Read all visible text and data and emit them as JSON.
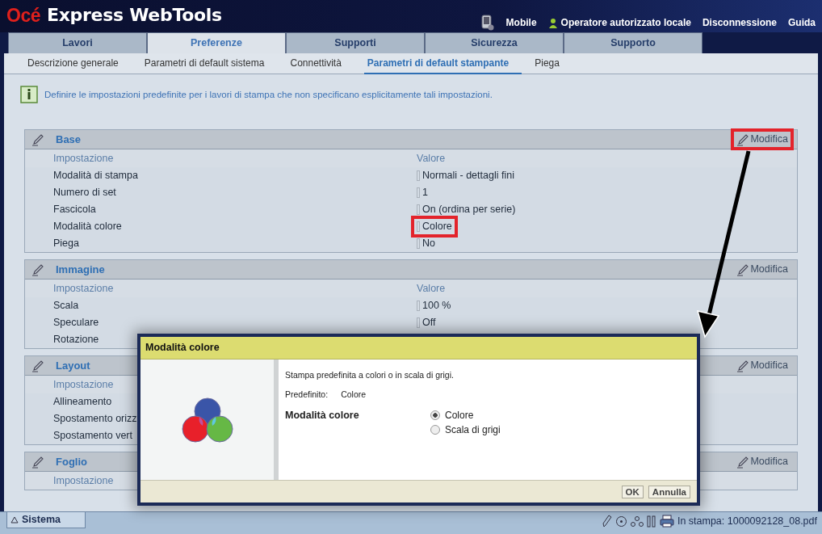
{
  "app": {
    "brand": "Océ",
    "title": "Express WebTools"
  },
  "header_links": [
    {
      "kind": "mobile",
      "label": "Mobile"
    },
    {
      "kind": "user",
      "label": "Operatore autorizzato locale"
    },
    {
      "kind": "plain",
      "label": "Disconnessione"
    },
    {
      "kind": "plain",
      "label": "Guida"
    }
  ],
  "tabs": [
    {
      "label": "Lavori",
      "selected": false
    },
    {
      "label": "Preferenze",
      "selected": true
    },
    {
      "label": "Supporti",
      "selected": false
    },
    {
      "label": "Sicurezza",
      "selected": false
    },
    {
      "label": "Supporto",
      "selected": false
    }
  ],
  "subtabs": [
    {
      "label": "Descrizione generale",
      "selected": false
    },
    {
      "label": "Parametri di default sistema",
      "selected": false
    },
    {
      "label": "Connettività",
      "selected": false
    },
    {
      "label": "Parametri di default stampante",
      "selected": true
    },
    {
      "label": "Piega",
      "selected": false
    }
  ],
  "info": "Definire le impostazioni predefinite per i lavori di stampa che non specificano esplicitamente tali impostazioni.",
  "sections": [
    {
      "title": "Base",
      "edit": {
        "label": "Modifica",
        "highlighted": true
      },
      "columns": [
        "Impostazione",
        "Valore"
      ],
      "rows": [
        {
          "setting": "Modalità di stampa",
          "value": "Normali - dettagli fini",
          "highlighted": false
        },
        {
          "setting": "Numero di set",
          "value": "1",
          "highlighted": false
        },
        {
          "setting": "Fascicola",
          "value": "On (ordina per serie)",
          "highlighted": false
        },
        {
          "setting": "Modalità colore",
          "value": "Colore",
          "highlighted": true
        },
        {
          "setting": "Piega",
          "value": "No",
          "highlighted": false
        }
      ]
    },
    {
      "title": "Immagine",
      "edit": {
        "label": "Modifica",
        "highlighted": false
      },
      "columns": [
        "Impostazione",
        "Valore"
      ],
      "rows": [
        {
          "setting": "Scala",
          "value": "100 %",
          "highlighted": false
        },
        {
          "setting": "Speculare",
          "value": "Off",
          "highlighted": false
        },
        {
          "setting": "Rotazione",
          "highlighted": false
        }
      ]
    },
    {
      "title": "Layout",
      "edit": {
        "label": "Modifica",
        "highlighted": false
      },
      "columns": [
        "Impostazione"
      ],
      "rows": [
        {
          "setting": "Allineamento",
          "highlighted": false
        },
        {
          "setting": "Spostamento orizz",
          "highlighted": false
        },
        {
          "setting": "Spostamento vert",
          "highlighted": false
        }
      ]
    },
    {
      "title": "Foglio",
      "edit": {
        "label": "Modifica",
        "highlighted": false
      },
      "columns": [
        "Impostazione"
      ]
    }
  ],
  "dialog": {
    "title": "Modalità colore",
    "description": "Stampa predefinita a colori o in scala di grigi.",
    "default_label": "Predefinito:",
    "default_value": "Colore",
    "option_label": "Modalità colore",
    "options": [
      {
        "label": "Colore",
        "selected": true
      },
      {
        "label": "Scala di grigi",
        "selected": false
      }
    ],
    "buttons": [
      "OK",
      "Annulla"
    ]
  },
  "status_bar": {
    "tab": "Sistema",
    "job": "In stampa: 1000092128_08.pdf"
  }
}
